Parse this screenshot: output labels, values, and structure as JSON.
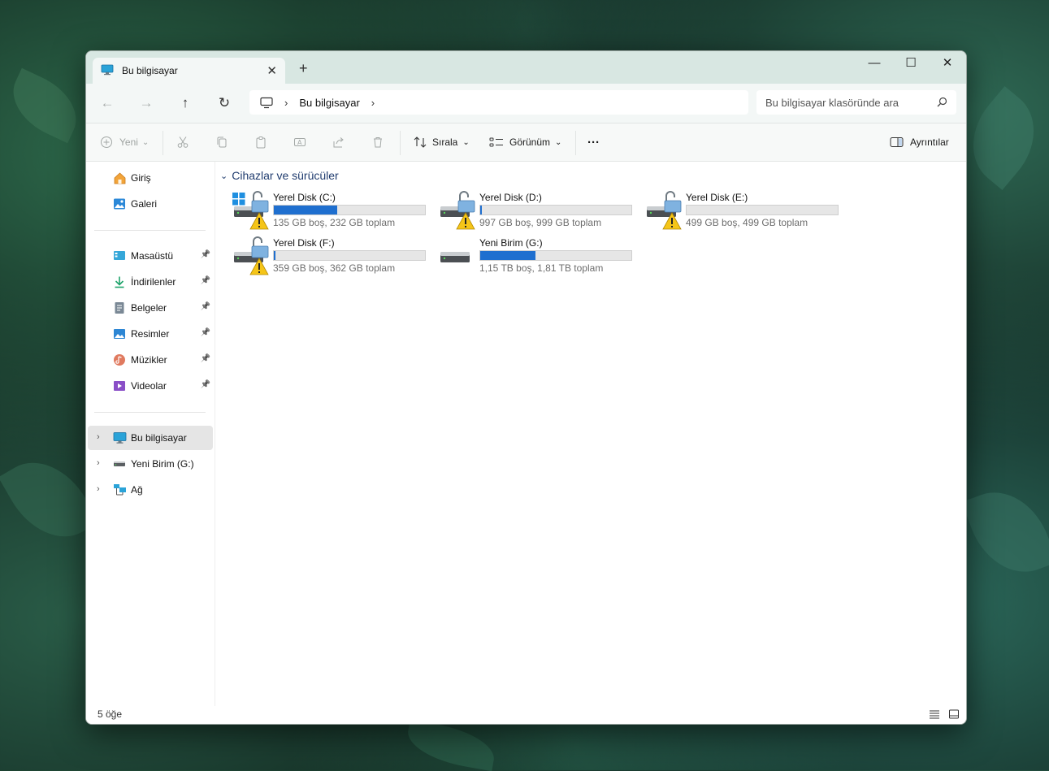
{
  "window": {
    "tab_title": "Bu bilgisayar",
    "tab_close": "✕",
    "new_tab": "+",
    "minimize": "—",
    "maximize": "☐",
    "close": "✕"
  },
  "nav": {
    "back": "←",
    "forward": "→",
    "up": "↑",
    "refresh": "↻",
    "breadcrumb": "Bu bilgisayar",
    "breadcrumb_sep": "›",
    "breadcrumb_end": "›",
    "search_placeholder": "Bu bilgisayar klasöründe ara"
  },
  "commands": {
    "new": "Yeni",
    "sort": "Sırala",
    "view": "Görünüm",
    "more": "···",
    "details": "Ayrıntılar",
    "dropdown": "⌄"
  },
  "sidebar": {
    "top": [
      {
        "label": "Giriş",
        "icon": "home-icon"
      },
      {
        "label": "Galeri",
        "icon": "gallery-icon"
      }
    ],
    "pinned": [
      {
        "label": "Masaüstü",
        "icon": "desktop-icon"
      },
      {
        "label": "İndirilenler",
        "icon": "download-icon"
      },
      {
        "label": "Belgeler",
        "icon": "documents-icon"
      },
      {
        "label": "Resimler",
        "icon": "pictures-icon"
      },
      {
        "label": "Müzikler",
        "icon": "music-icon"
      },
      {
        "label": "Videolar",
        "icon": "videos-icon"
      }
    ],
    "locations": [
      {
        "label": "Bu bilgisayar",
        "icon": "computer-icon"
      },
      {
        "label": "Yeni Birim (G:)",
        "icon": "drive-icon"
      },
      {
        "label": "Ağ",
        "icon": "network-icon"
      }
    ],
    "pin_glyph": "📌",
    "expand_glyph": "›"
  },
  "group": {
    "title": "Cihazlar ve sürücüler",
    "chevron": "⌄"
  },
  "drives": [
    {
      "name": "Yerel Disk (C:)",
      "info": "135 GB boş, 232 GB toplam",
      "used_fraction": 0.42,
      "locked": true,
      "windows": true
    },
    {
      "name": "Yerel Disk (D:)",
      "info": "997 GB boş, 999 GB toplam",
      "used_fraction": 0.002,
      "locked": true,
      "windows": false
    },
    {
      "name": "Yerel Disk (E:)",
      "info": "499 GB boş, 499 GB toplam",
      "used_fraction": 0.0,
      "locked": true,
      "windows": false
    },
    {
      "name": "Yerel Disk (F:)",
      "info": "359 GB boş, 362 GB toplam",
      "used_fraction": 0.008,
      "locked": true,
      "windows": false
    },
    {
      "name": "Yeni Birim (G:)",
      "info": "1,15 TB boş, 1,81 TB toplam",
      "used_fraction": 0.365,
      "locked": false,
      "windows": false
    }
  ],
  "status": {
    "count": "5 öğe"
  },
  "colors": {
    "accent": "#1f6fcf",
    "group_title": "#1f3b6e",
    "titlebar": "#d8e7e2"
  }
}
